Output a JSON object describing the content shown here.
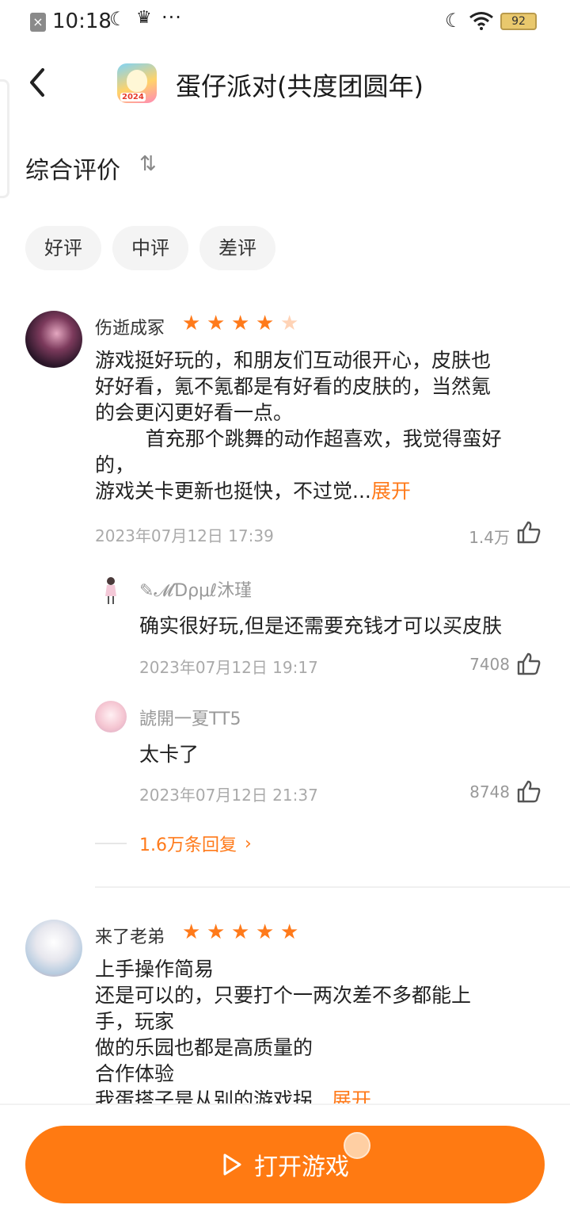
{
  "status_bar": {
    "time": "10:18",
    "battery": "92",
    "dots": "···"
  },
  "header": {
    "title": "蛋仔派对(共度团圆年)",
    "app_icon_badge": "2024"
  },
  "section": {
    "title": "综合评价",
    "sort_icon_text": "⇅"
  },
  "filters": [
    "好评",
    "中评",
    "差评"
  ],
  "reviews": [
    {
      "user": "伤逝成冢",
      "rating": 4,
      "body_lines": [
        "游戏挺好玩的，和朋友们互动很开心，皮肤也",
        "好好看，氪不氪都是有好看的皮肤的，当然氪",
        "的会更闪更好看一点。",
        "        首充那个跳舞的动作超喜欢，我觉得蛮好",
        "的，",
        "游戏关卡更新也挺快，不过觉..."
      ],
      "expand_label": "展开",
      "date": "2023年07月12日 17:39",
      "likes": "1.4万",
      "replies": [
        {
          "user": "✎𝓜Ɗρμℓ沐瑾",
          "text": "确实很好玩,但是还需要充钱才可以买皮肤",
          "date": "2023年07月12日 19:17",
          "likes": "7408"
        },
        {
          "user": "諕開一夏TT5",
          "text": "太卡了",
          "date": "2023年07月12日 21:37",
          "likes": "8748"
        }
      ],
      "more_replies": "1.6万条回复"
    },
    {
      "user": "来了老弟",
      "rating": 5,
      "body_lines": [
        "上手操作简易",
        "还是可以的，只要打个一两次差不多都能上",
        "手，玩家",
        "做的乐园也都是高质量的",
        "合作体验",
        "我蛋搭子是从别的游戏拐..."
      ],
      "expand_label": "展开"
    }
  ],
  "bottom": {
    "open_button": "打开游戏"
  },
  "colors": {
    "accent": "#ff7a12",
    "star": "#ff7a1a",
    "chip_bg": "#f4f4f4"
  }
}
